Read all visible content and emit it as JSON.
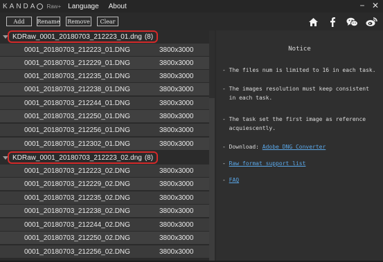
{
  "app": {
    "brand": "KANDA",
    "brand_suffix": "Raw+",
    "menu": [
      "Language",
      "About"
    ],
    "window_controls": {
      "minimize": "−",
      "close": "✕"
    }
  },
  "toolbar": {
    "buttons": [
      "Add",
      "Rename",
      "Remove",
      "Clear"
    ],
    "social_icons": [
      "home-icon",
      "facebook-icon",
      "wechat-icon",
      "weibo-icon"
    ]
  },
  "groups": [
    {
      "title": "KDRaw_0001_20180703_212223_01.dng",
      "count": "(8)",
      "files": [
        {
          "name": "0001_20180703_212223_01.DNG",
          "res": "3800x3000"
        },
        {
          "name": "0001_20180703_212229_01.DNG",
          "res": "3800x3000"
        },
        {
          "name": "0001_20180703_212235_01.DNG",
          "res": "3800x3000"
        },
        {
          "name": "0001_20180703_212238_01.DNG",
          "res": "3800x3000"
        },
        {
          "name": "0001_20180703_212244_01.DNG",
          "res": "3800x3000"
        },
        {
          "name": "0001_20180703_212250_01.DNG",
          "res": "3800x3000"
        },
        {
          "name": "0001_20180703_212256_01.DNG",
          "res": "3800x3000"
        },
        {
          "name": "0001_20180703_212302_01.DNG",
          "res": "3800x3000"
        }
      ]
    },
    {
      "title": "KDRaw_0001_20180703_212223_02.dng",
      "count": "(8)",
      "files": [
        {
          "name": "0001_20180703_212223_02.DNG",
          "res": "3800x3000"
        },
        {
          "name": "0001_20180703_212229_02.DNG",
          "res": "3800x3000"
        },
        {
          "name": "0001_20180703_212235_02.DNG",
          "res": "3800x3000"
        },
        {
          "name": "0001_20180703_212238_02.DNG",
          "res": "3800x3000"
        },
        {
          "name": "0001_20180703_212244_02.DNG",
          "res": "3800x3000"
        },
        {
          "name": "0001_20180703_212250_02.DNG",
          "res": "3800x3000"
        },
        {
          "name": "0001_20180703_212256_02.DNG",
          "res": "3800x3000"
        }
      ]
    }
  ],
  "notice": {
    "title": "Notice",
    "items": [
      "- The files num is limited to 16 in each task.",
      "- The images resolution must keep consistent\n  in each task.",
      "- The task set the first image as reference\n  acquiescently."
    ],
    "download_label": "- Download: ",
    "download_link": "Adobe DNG Converter",
    "raw_prefix": "- ",
    "raw_link": "Raw format support list",
    "faq_prefix": "- ",
    "faq_link": "FAQ"
  },
  "colors": {
    "highlight_border": "#d42a2a",
    "link": "#5aa7e8",
    "background": "#2a2a2a"
  }
}
